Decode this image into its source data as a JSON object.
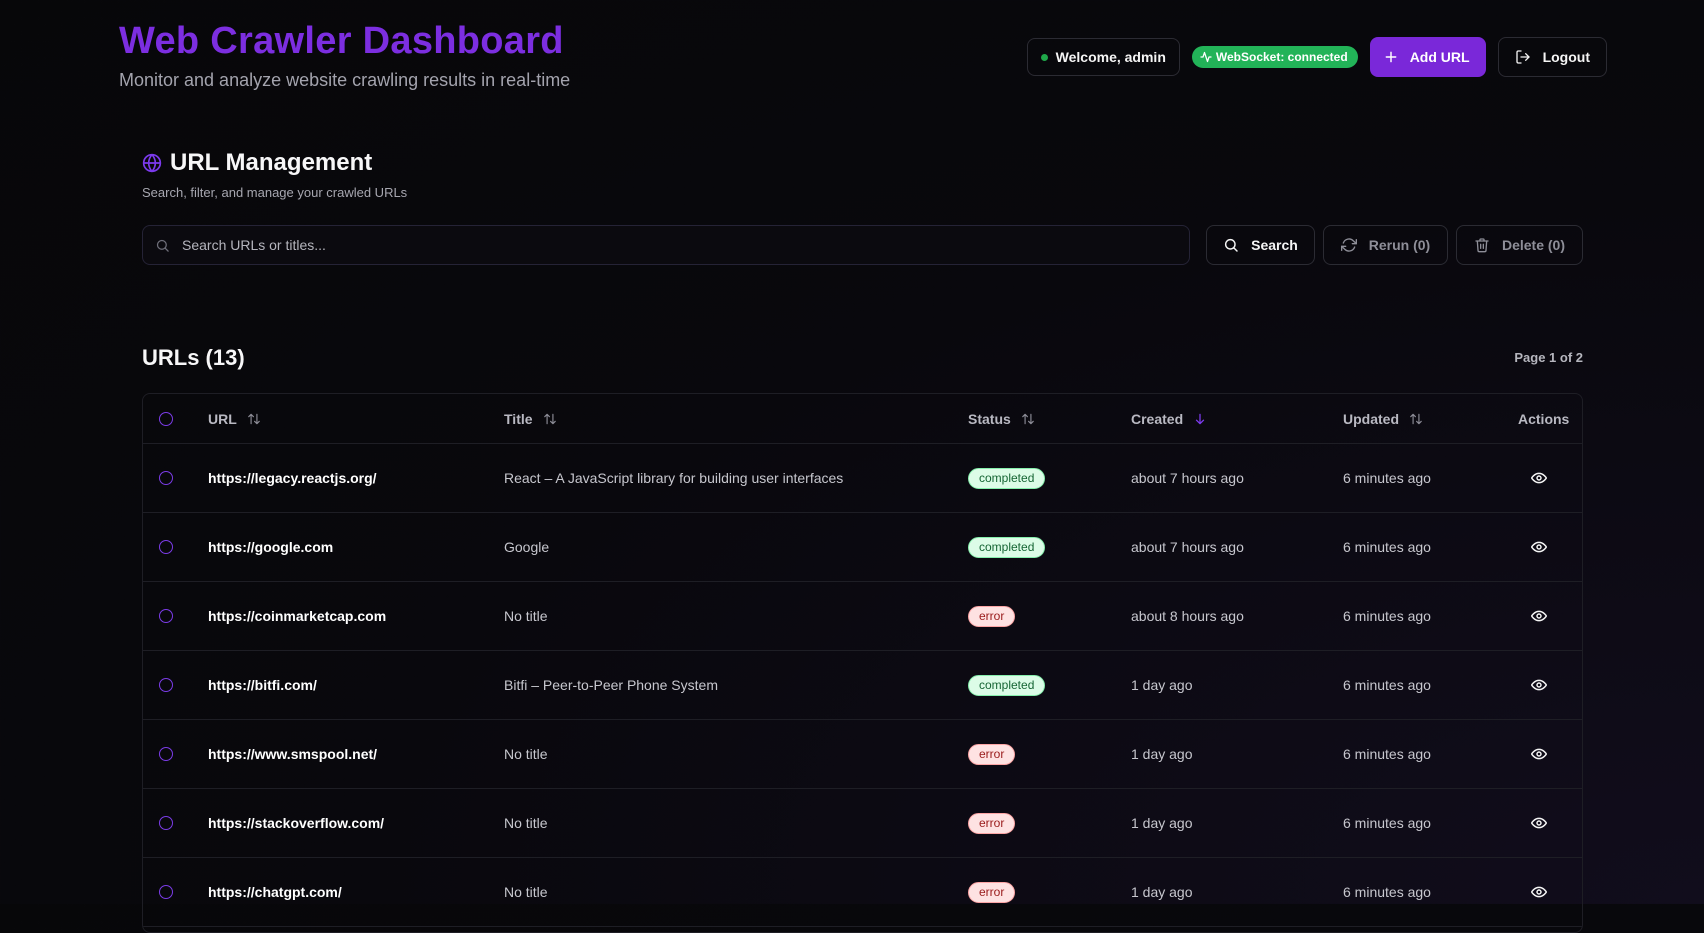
{
  "header": {
    "title": "Web Crawler Dashboard",
    "subtitle": "Monitor and analyze website crawling results in real-time",
    "welcome": "Welcome, admin",
    "websocket": "WebSocket: connected",
    "add_url": "Add URL",
    "logout": "Logout"
  },
  "management": {
    "title": "URL Management",
    "description": "Search, filter, and manage your crawled URLs",
    "search_placeholder": "Search URLs or titles...",
    "search_label": "Search",
    "rerun_label": "Rerun (0)",
    "delete_label": "Delete (0)"
  },
  "urls": {
    "title": "URLs (13)",
    "page_info": "Page 1 of 2"
  },
  "table": {
    "headers": {
      "url": "URL",
      "title": "Title",
      "status": "Status",
      "created": "Created",
      "updated": "Updated",
      "actions": "Actions"
    },
    "rows": [
      {
        "url": "https://legacy.reactjs.org/",
        "title": "React – A JavaScript library for building user interfaces",
        "status": "completed",
        "created": "about 7 hours ago",
        "updated": "6 minutes ago"
      },
      {
        "url": "https://google.com",
        "title": "Google",
        "status": "completed",
        "created": "about 7 hours ago",
        "updated": "6 minutes ago"
      },
      {
        "url": "https://coinmarketcap.com",
        "title": "No title",
        "status": "error",
        "created": "about 8 hours ago",
        "updated": "6 minutes ago"
      },
      {
        "url": "https://bitfi.com/",
        "title": "Bitfi – Peer-to-Peer Phone System",
        "status": "completed",
        "created": "1 day ago",
        "updated": "6 minutes ago"
      },
      {
        "url": "https://www.smspool.net/",
        "title": "No title",
        "status": "error",
        "created": "1 day ago",
        "updated": "6 minutes ago"
      },
      {
        "url": "https://stackoverflow.com/",
        "title": "No title",
        "status": "error",
        "created": "1 day ago",
        "updated": "6 minutes ago"
      },
      {
        "url": "https://chatgpt.com/",
        "title": "No title",
        "status": "error",
        "created": "1 day ago",
        "updated": "6 minutes ago"
      }
    ]
  },
  "colors": {
    "accent": "#7c2ee0",
    "success": "#22b358",
    "error": "#fee2e2"
  }
}
